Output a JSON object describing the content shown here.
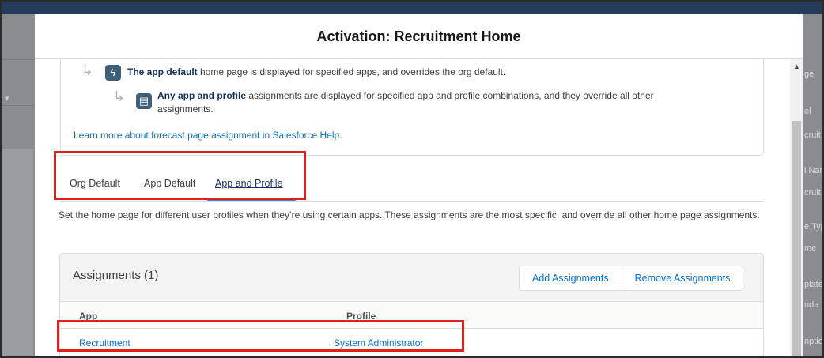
{
  "modal": {
    "title": "Activation: Recruitment Home"
  },
  "info": {
    "app_default_bold": "The app default",
    "app_default_rest": " home page is displayed for specified apps, and overrides the org default.",
    "app_profile_bold": "Any app and profile",
    "app_profile_rest_1": " assignments are displayed for specified app and profile combinations, and they override all other",
    "app_profile_rest_2": "assignments.",
    "learn_more": "Learn more about forecast page assignment in Salesforce Help."
  },
  "tabs": [
    {
      "label": "Org Default"
    },
    {
      "label": "App Default"
    },
    {
      "label": "App and Profile",
      "active": true
    }
  ],
  "description": "Set the home page for different user profiles when they’re using certain apps. These assignments are the most specific, and override all other home page assignments.",
  "assignments": {
    "title": "Assignments (1)",
    "add_label": "Add Assignments",
    "remove_label": "Remove Assignments",
    "columns": [
      "App",
      "Profile"
    ],
    "rows": [
      {
        "app": "Recruitment",
        "profile": "System Administrator"
      }
    ]
  },
  "background_right": [
    "ge",
    "el",
    "cruit",
    "l Nar",
    "cruit",
    "e Typ",
    "me",
    "plate",
    "nda",
    "nptio"
  ],
  "icons": {
    "app_default": "lightning-icon",
    "app_profile": "clipboard-icon"
  },
  "colors": {
    "highlight": "#e02020",
    "link": "#0070d2",
    "tab_active_underline": "#1b96ff"
  }
}
